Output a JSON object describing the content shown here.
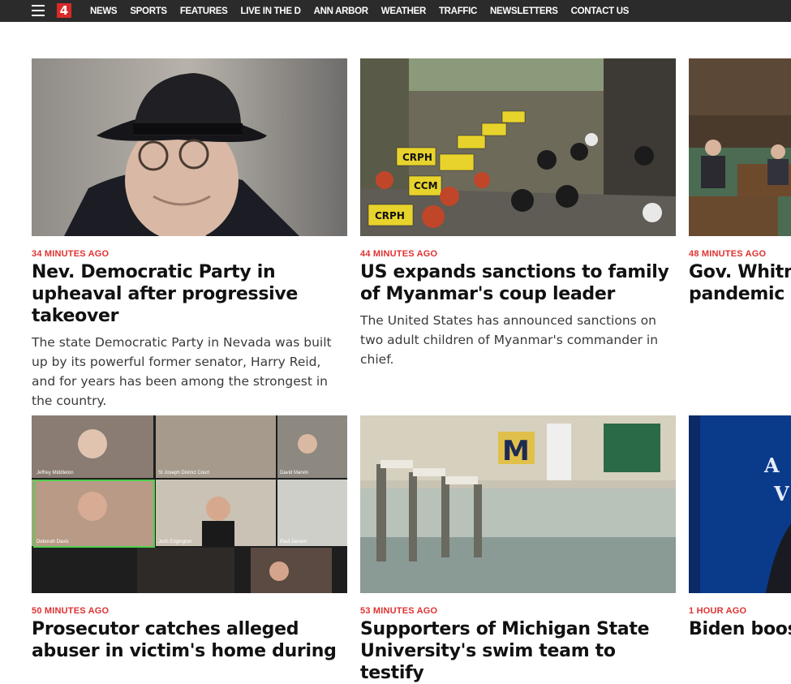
{
  "nav": {
    "logo": "4",
    "links": [
      "NEWS",
      "SPORTS",
      "FEATURES",
      "LIVE IN THE D",
      "ANN ARBOR",
      "WEATHER",
      "TRAFFIC",
      "NEWSLETTERS",
      "CONTACT US"
    ]
  },
  "colors": {
    "nav_bg": "#2b2b2b",
    "accent": "#e03131",
    "logo_bg": "#d92a2a"
  },
  "articles": [
    {
      "time": "34 MINUTES AGO",
      "headline": "Nev. Democratic Party in upheaval after progressive takeover",
      "summary": "The state Democratic Party in Nevada was built up by its powerful former senator, Harry Reid, and for years has been among the strongest in the country."
    },
    {
      "time": "44 MINUTES AGO",
      "headline": "US expands sanctions to family of Myanmar's coup leader",
      "summary": "The United States has announced sanctions on two adult children of Myanmar's commander in chief."
    },
    {
      "time": "48 MINUTES AGO",
      "headline": "Gov. Whitmer on COVID pandemic anniversary"
    },
    {
      "time": "50 MINUTES AGO",
      "headline": "Prosecutor catches alleged abuser in victim's home during"
    },
    {
      "time": "53 MINUTES AGO",
      "headline": "Supporters of Michigan State University's swim team to testify"
    },
    {
      "time": "1 HOUR AGO",
      "headline": "Biden boosts stockpile"
    }
  ],
  "image_labels": {
    "protest_signs": [
      "CRPH",
      "CCM"
    ],
    "zoom_names": [
      "Jeffrey Middleton",
      "St Joseph District Court",
      "David Marvin",
      "Deborah Davis",
      "Josh Edgington",
      "Paul Jansen"
    ],
    "pool_letter": "M",
    "biden_backdrop": [
      "A",
      "V"
    ]
  }
}
